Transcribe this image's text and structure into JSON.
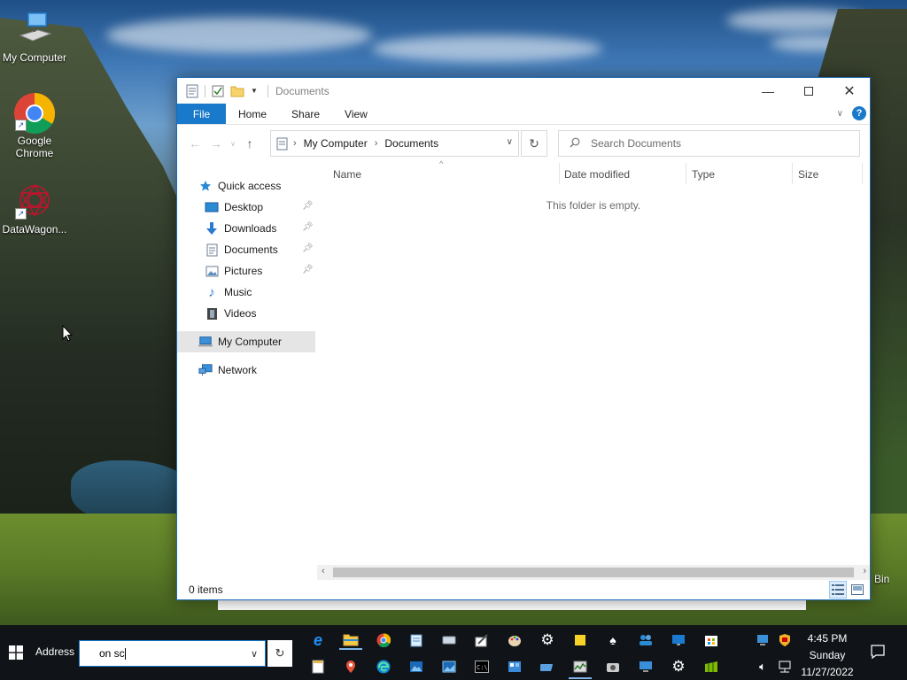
{
  "desktop": {
    "icons": [
      {
        "label": "My Computer"
      },
      {
        "label": "Google Chrome"
      },
      {
        "label": "DataWagon..."
      }
    ],
    "recycle_bin_partial_label": "Bin"
  },
  "window": {
    "title": "Documents",
    "ribbon_tabs": [
      "File",
      "Home",
      "Share",
      "View"
    ],
    "breadcrumb": [
      "My Computer",
      "Documents"
    ],
    "search_placeholder": "Search Documents",
    "nav_pane": {
      "quick_access": "Quick access",
      "items": [
        {
          "label": "Desktop",
          "pinned": true
        },
        {
          "label": "Downloads",
          "pinned": true
        },
        {
          "label": "Documents",
          "pinned": true
        },
        {
          "label": "Pictures",
          "pinned": true
        },
        {
          "label": "Music",
          "pinned": false
        },
        {
          "label": "Videos",
          "pinned": false
        }
      ],
      "my_computer": "My Computer",
      "network": "Network"
    },
    "columns": [
      "Name",
      "Date modified",
      "Type",
      "Size"
    ],
    "empty_message": "This folder is empty.",
    "status": "0 items"
  },
  "taskbar": {
    "address_label": "Address",
    "address_value": "on sc",
    "clock": {
      "time": "4:45 PM",
      "day": "Sunday",
      "date": "11/27/2022"
    }
  },
  "colors": {
    "accent": "#1979ca",
    "selection": "#e5e5e5",
    "taskbar": "#101418"
  }
}
